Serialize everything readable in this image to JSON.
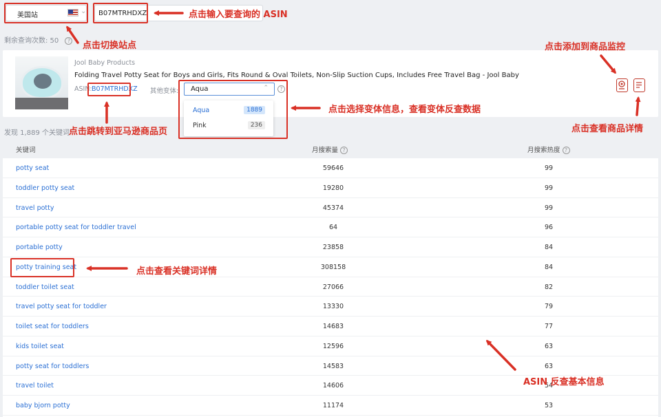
{
  "top": {
    "site_label": "美国站",
    "asin_value": "B07MTRHDXZ",
    "remaining": "剩余查询次数: 50"
  },
  "product": {
    "brand": "Jool Baby Products",
    "title": "Folding Travel Potty Seat for Boys and Girls, Fits Round & Oval Toilets, Non-Slip Suction Cups, Includes Free Travel Bag - Jool Baby",
    "asin_label": "ASIN:",
    "asin": "B07MTRHDXZ",
    "variant_label": "其他变体:",
    "variant_selected": "Aqua",
    "variants": [
      {
        "name": "Aqua",
        "count": "1889"
      },
      {
        "name": "Pink",
        "count": "236"
      }
    ]
  },
  "found_text": "发现 1,889 个关键词",
  "table": {
    "headers": [
      "关键词",
      "月搜索量",
      "月搜索热度"
    ],
    "rows": [
      {
        "keyword": "potty seat",
        "volume": "59646",
        "heat": "99"
      },
      {
        "keyword": "toddler potty seat",
        "volume": "19280",
        "heat": "99"
      },
      {
        "keyword": "travel potty",
        "volume": "45374",
        "heat": "99"
      },
      {
        "keyword": "portable potty seat for toddler travel",
        "volume": "64",
        "heat": "96"
      },
      {
        "keyword": "portable potty",
        "volume": "23858",
        "heat": "84"
      },
      {
        "keyword": "potty training seat",
        "volume": "308158",
        "heat": "84"
      },
      {
        "keyword": "toddler toilet seat",
        "volume": "27066",
        "heat": "82"
      },
      {
        "keyword": "travel potty seat for toddler",
        "volume": "13330",
        "heat": "79"
      },
      {
        "keyword": "toilet seat for toddlers",
        "volume": "14683",
        "heat": "77"
      },
      {
        "keyword": "kids toilet seat",
        "volume": "12596",
        "heat": "63"
      },
      {
        "keyword": "potty seat for toddlers",
        "volume": "14583",
        "heat": "63"
      },
      {
        "keyword": "travel toilet",
        "volume": "14606",
        "heat": "54"
      },
      {
        "keyword": "baby bjorn potty",
        "volume": "11174",
        "heat": "53"
      }
    ]
  },
  "annotations": {
    "asin_input": "点击输入要查询的 ASIN",
    "switch_site": "点击切换站点",
    "add_monitor": "点击添加到商品监控",
    "variant": "点击选择变体信息，查看变体反查数据",
    "amazon_page": "点击跳转到亚马逊商品页",
    "product_detail": "点击查看商品详情",
    "keyword_detail": "点击查看关键词详情",
    "basic_info": "ASIN 反查基本信息"
  },
  "colors": {
    "annotation": "#d93025",
    "link": "#2a6fd4"
  }
}
